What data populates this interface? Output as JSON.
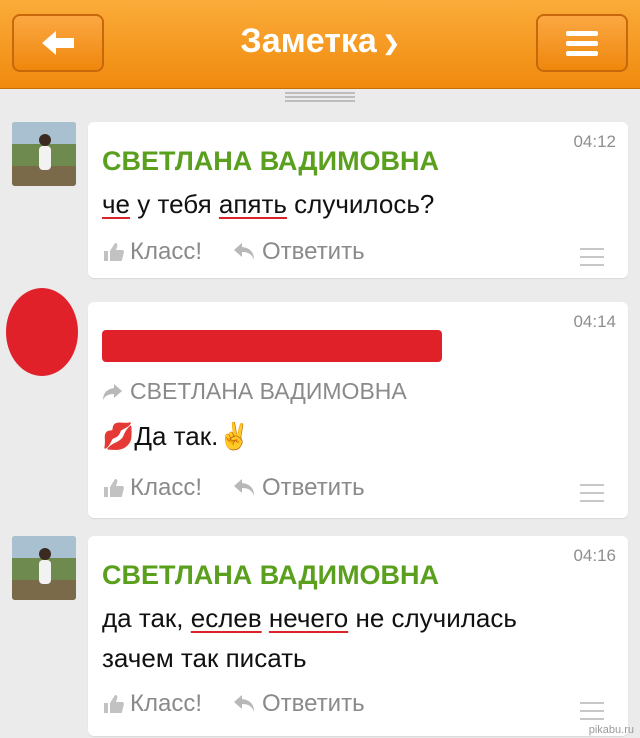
{
  "header": {
    "title": "Заметка",
    "title_chevron": "chevron-down-icon",
    "back_icon": "arrow-left-icon",
    "menu_icon": "hamburger-icon"
  },
  "colors": {
    "header_orange": "#f5961e",
    "author_green": "#5aa01e",
    "redaction_red": "#e0212a"
  },
  "actions": {
    "like_label": "Класс!",
    "reply_label": "Ответить"
  },
  "messages": [
    {
      "time": "04:12",
      "author": "СВЕТЛАНА ВАДИМОВНА",
      "text_parts": [
        "че",
        " у тебя ",
        "апять",
        " случилось?"
      ]
    },
    {
      "time": "04:14",
      "forwarded_from": "СВЕТЛАНА ВАДИМОВНА",
      "text": "Да так.",
      "emoji_before": "💋",
      "emoji_after": "✌"
    },
    {
      "time": "04:16",
      "author": "СВЕТЛАНА ВАДИМОВНА",
      "text_parts": [
        "да так, ",
        "еслев",
        " ",
        "нечего",
        " не случилась"
      ],
      "text_line2": "зачем так писать"
    }
  ],
  "watermark": "pikabu.ru"
}
